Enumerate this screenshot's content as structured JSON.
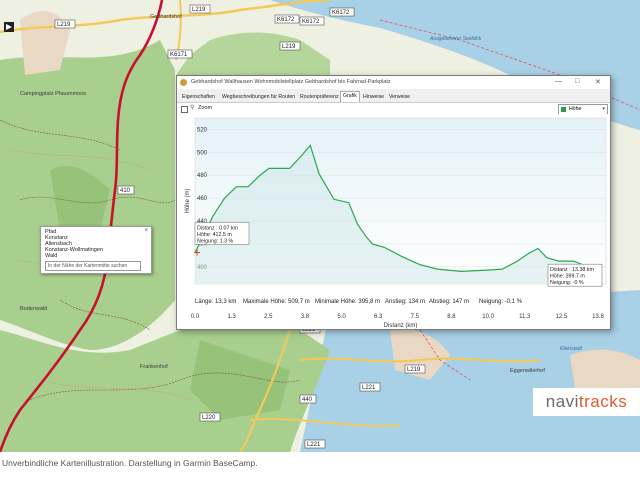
{
  "map": {
    "roads": [
      "L219",
      "K6172",
      "K6172",
      "L219",
      "K6171",
      "L219",
      "K6172",
      "410",
      "L221",
      "L219",
      "L221",
      "440",
      "L221",
      "L220"
    ],
    "places": [
      "Gebhardshof",
      "Campingplatz Pfauenmoos",
      "Bodenwald",
      "Frankenhof",
      "Eggenwilerhof"
    ],
    "lake_text": [
      "Ausgedehnter Seeblick",
      "Kleinstadt"
    ],
    "caption": "Unverbindliche Kartenillustration. Darstellung in Garmin BaseCamp."
  },
  "logo": {
    "part1": "navi",
    "part2": "tracks"
  },
  "popup": {
    "lines": [
      "Pfad",
      "Konstanz",
      "Allensbach",
      "Konstanz-Wollmatingen",
      "Wald"
    ],
    "search_placeholder": "In der Nähe der Kartenmitte suchen",
    "close": "×"
  },
  "window": {
    "title": "Gebhardshof Wallhausen Wohnmobilstellplatz Gebhardshof bis Fahrrad-Parkplatz",
    "controls": {
      "minimize": "—",
      "maximize": "□",
      "close": "✕"
    },
    "tabs": [
      "Eigenschaften",
      "Wegbeschreibungen für Routen",
      "Routenpräferenz",
      "Grafik",
      "Hinweise",
      "Verweise"
    ],
    "active_tab": "Grafik",
    "zoom_label": "Zoom",
    "dropdown": {
      "value": "Höhe",
      "arrow": "▾"
    }
  },
  "chart_data": {
    "type": "area",
    "xlabel": "Distanz  (km)",
    "ylabel": "Höhe (m)",
    "xlim": [
      0,
      13.9
    ],
    "ylim": [
      385,
      530
    ],
    "xticks": [
      "0.0",
      "1.3",
      "2.3",
      "3.6",
      "4.8",
      "5.9",
      "7.1",
      "8.2",
      "9.4",
      "10.6",
      "11.7",
      "12.9",
      "14.1"
    ],
    "xtick_labels": [
      "0.0",
      "1.3",
      "2.5",
      "3.8",
      "5.0",
      "6.3",
      "7.5",
      "8.8",
      "10.0",
      "11.3",
      "12.5",
      "13.8"
    ],
    "yticks": [
      400,
      420,
      440,
      460,
      480,
      500,
      520
    ],
    "x": [
      0.0,
      0.3,
      0.6,
      1.0,
      1.4,
      1.8,
      2.2,
      2.5,
      2.8,
      3.2,
      3.6,
      3.9,
      4.2,
      4.7,
      5.2,
      5.5,
      5.8,
      6.0,
      6.4,
      7.0,
      7.6,
      8.2,
      9.0,
      9.8,
      10.4,
      10.9,
      11.3,
      11.6,
      11.9,
      12.3,
      12.8,
      13.2,
      13.38
    ],
    "y": [
      412.5,
      428,
      444,
      460,
      470,
      470,
      480,
      486,
      486,
      486,
      497,
      506,
      481,
      459,
      456,
      437,
      426,
      420,
      417,
      409,
      402,
      398,
      396,
      397,
      398,
      405,
      412,
      416,
      408,
      405,
      405,
      401,
      399.7
    ],
    "stats": {
      "length": "Länge: 13,3 km",
      "max": "Maximale Höhe: 509,7 m",
      "min": "Minimale Höhe: 395,8 m",
      "ascent": "Anstieg: 134 m",
      "descent": "Abstieg: 147 m",
      "slope": "Neigung: -0,1 %"
    },
    "tooltips": [
      {
        "lines": [
          "Distanz : 0.07 km",
          "Höhe: 412.5 m",
          "Neigung: 1.3 %"
        ],
        "x": 0.07,
        "y": 412.5
      },
      {
        "lines": [
          "Distanz : 13.38 km",
          "Höhe: 399.7 m",
          "Neigung: -0 %"
        ],
        "x": 13.38,
        "y": 399.7
      }
    ],
    "colors": {
      "line": "#2aa84a",
      "fill_top": "#e4f2f8",
      "fill_bottom": "#ffffff",
      "grid": "#d9dfe4",
      "marker": "#e23b2e"
    }
  }
}
